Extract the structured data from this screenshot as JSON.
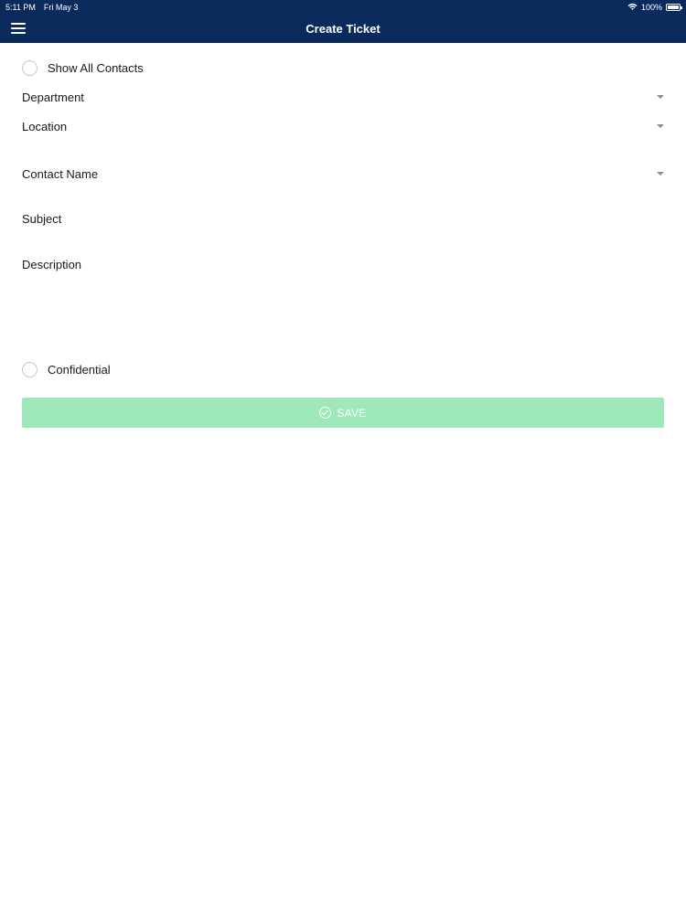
{
  "status_bar": {
    "time": "5:11 PM",
    "date": "Fri May 3",
    "battery": "100%"
  },
  "nav": {
    "title": "Create Ticket",
    "menu_icon": "hamburger-menu-icon"
  },
  "form": {
    "show_all_contacts_label": "Show All Contacts",
    "department_label": "Department",
    "location_label": "Location",
    "contact_name_label": "Contact Name",
    "subject_label": "Subject",
    "description_label": "Description",
    "confidential_label": "Confidential",
    "save_label": "SAVE"
  },
  "colors": {
    "header_bg": "#0b2a5c",
    "save_button_bg": "#9ee8b9"
  }
}
